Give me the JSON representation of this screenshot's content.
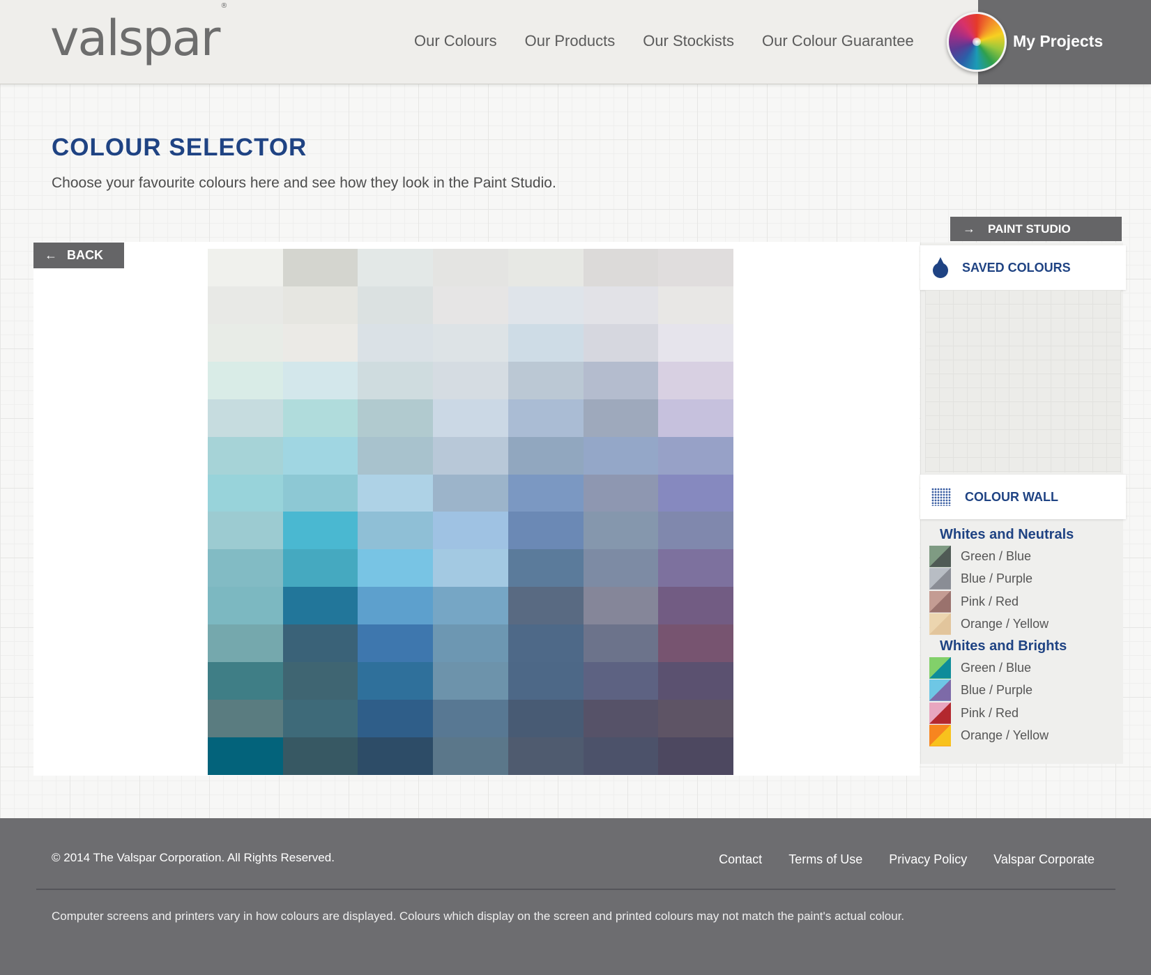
{
  "header": {
    "logo": "valspar",
    "logo_mark": "®",
    "nav": [
      "Our Colours",
      "Our Products",
      "Our Stockists",
      "Our Colour Guarantee"
    ],
    "my_projects": "My Projects"
  },
  "page": {
    "title": "COLOUR SELECTOR",
    "subtitle": "Choose your favourite colours here and see how they look in the Paint Studio."
  },
  "buttons": {
    "back": "BACK",
    "paint_studio": "PAINT STUDIO"
  },
  "sidebar": {
    "saved_colours": "SAVED COLOURS",
    "colour_wall": "COLOUR WALL",
    "categories": [
      {
        "title": "Whites and Neutrals",
        "items": [
          {
            "label": "Green / Blue",
            "colors": [
              "#7f9b83",
              "#4f5a55"
            ]
          },
          {
            "label": "Blue / Purple",
            "colors": [
              "#b8bdc4",
              "#8a8d95"
            ]
          },
          {
            "label": "Pink / Red",
            "colors": [
              "#c49c93",
              "#9a726d"
            ]
          },
          {
            "label": "Orange / Yellow",
            "colors": [
              "#ecd5af",
              "#e2c59c"
            ]
          }
        ]
      },
      {
        "title": "Whites and Brights",
        "items": [
          {
            "label": "Green / Blue",
            "colors": [
              "#82d06a",
              "#0e8c9a"
            ]
          },
          {
            "label": "Blue / Purple",
            "colors": [
              "#6ec7e5",
              "#7d6aa8"
            ]
          },
          {
            "label": "Pink / Red",
            "colors": [
              "#e8a6bf",
              "#b3282e"
            ]
          },
          {
            "label": "Orange / Yellow",
            "colors": [
              "#f7851f",
              "#f8c21d"
            ]
          }
        ]
      }
    ]
  },
  "colour_grid": [
    [
      "#f0f1ed",
      "#d4d5cf",
      "#e3e8e7",
      "#e4e4e2",
      "#e7e8e4",
      "#dcdad9",
      "#e0dddd"
    ],
    [
      "#e8e9e6",
      "#e6e6e1",
      "#dbe1e1",
      "#e6e5e5",
      "#dfe4ea",
      "#e2e2e7",
      "#e8e7e5"
    ],
    [
      "#e8ece7",
      "#ebeae6",
      "#dae1e6",
      "#dde3e6",
      "#cedce6",
      "#d6d7df",
      "#e6e4ec"
    ],
    [
      "#d9ece7",
      "#d3e7eb",
      "#cfdcdf",
      "#d5dce2",
      "#bbc8d4",
      "#b4bcce",
      "#d8d0e2"
    ],
    [
      "#c6dcdf",
      "#b0dcdc",
      "#b1cacf",
      "#cbd8e5",
      "#aabcd4",
      "#9ea9bc",
      "#c6c1dd"
    ],
    [
      "#a6d3d7",
      "#a0d6e2",
      "#a8c2cd",
      "#b8c8d8",
      "#91a7bf",
      "#94a7c8",
      "#97a1c7"
    ],
    [
      "#98d3da",
      "#8dc8d4",
      "#aed2e6",
      "#9cb4ca",
      "#7b98c2",
      "#8e97b1",
      "#8689bf"
    ],
    [
      "#9ccbd1",
      "#4ab8d1",
      "#8fbfd6",
      "#9fc2e3",
      "#6b89b5",
      "#8597ad",
      "#8088ad"
    ],
    [
      "#82bbc4",
      "#45a9c0",
      "#78c4e4",
      "#a3c9e2",
      "#5b7b9b",
      "#7d8ba4",
      "#7d719e"
    ],
    [
      "#7cb8c1",
      "#22769a",
      "#5da0cd",
      "#76a6c5",
      "#596a82",
      "#858699",
      "#725c83"
    ],
    [
      "#75a8ad",
      "#3a6278",
      "#3e77ae",
      "#6d97b2",
      "#4e6988",
      "#6c738b",
      "#775470"
    ],
    [
      "#3f7e86",
      "#3f6572",
      "#2f709b",
      "#6d93ab",
      "#4d6887",
      "#5d6282",
      "#5b5170"
    ],
    [
      "#5a7c80",
      "#3e6a79",
      "#2f5e89",
      "#587893",
      "#485b74",
      "#565268",
      "#5e5465"
    ],
    [
      "#03637b",
      "#375863",
      "#2d4c67",
      "#5b778a",
      "#4f5b6f",
      "#4c526a",
      "#4d4860"
    ]
  ],
  "footer": {
    "copyright": "© 2014 The Valspar Corporation. All Rights Reserved.",
    "links": [
      "Contact",
      "Terms of Use",
      "Privacy Policy",
      "Valspar Corporate"
    ],
    "disclaimer": "Computer screens and printers vary in how colours are displayed. Colours which display on the screen and printed colours may not match the paint's actual colour."
  }
}
